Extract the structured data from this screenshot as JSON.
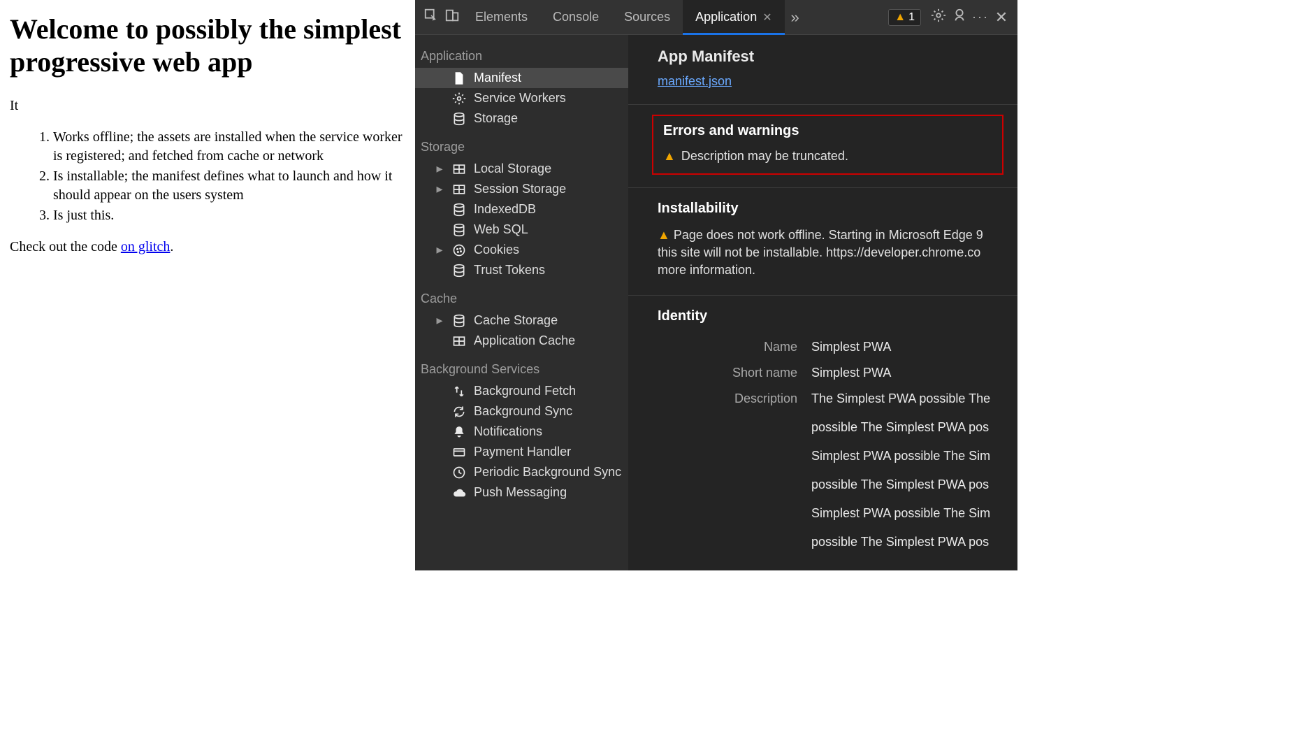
{
  "page": {
    "heading": "Welcome to possibly the simplest progressive web app",
    "intro": "It",
    "list": [
      "Works offline; the assets are installed when the service worker is registered; and fetched from cache or network",
      "Is installable; the manifest defines what to launch and how it should appear on the users system",
      "Is just this."
    ],
    "outro_prefix": "Check out the code ",
    "outro_link": "on glitch",
    "outro_suffix": "."
  },
  "devtools": {
    "tabs": {
      "elements": "Elements",
      "console": "Console",
      "sources": "Sources",
      "application": "Application"
    },
    "warning_count": "1",
    "sidebar": {
      "application": {
        "title": "Application",
        "items": [
          {
            "icon": "file",
            "label": "Manifest",
            "selected": true
          },
          {
            "icon": "gear",
            "label": "Service Workers"
          },
          {
            "icon": "db",
            "label": "Storage"
          }
        ]
      },
      "storage": {
        "title": "Storage",
        "items": [
          {
            "icon": "grid",
            "label": "Local Storage",
            "expandable": true
          },
          {
            "icon": "grid",
            "label": "Session Storage",
            "expandable": true
          },
          {
            "icon": "db",
            "label": "IndexedDB"
          },
          {
            "icon": "db",
            "label": "Web SQL"
          },
          {
            "icon": "cookie",
            "label": "Cookies",
            "expandable": true
          },
          {
            "icon": "db",
            "label": "Trust Tokens"
          }
        ]
      },
      "cache": {
        "title": "Cache",
        "items": [
          {
            "icon": "db",
            "label": "Cache Storage",
            "expandable": true
          },
          {
            "icon": "grid",
            "label": "Application Cache"
          }
        ]
      },
      "bgservices": {
        "title": "Background Services",
        "items": [
          {
            "icon": "updown",
            "label": "Background Fetch"
          },
          {
            "icon": "sync",
            "label": "Background Sync"
          },
          {
            "icon": "bell",
            "label": "Notifications"
          },
          {
            "icon": "card",
            "label": "Payment Handler"
          },
          {
            "icon": "clock",
            "label": "Periodic Background Sync"
          },
          {
            "icon": "cloud",
            "label": "Push Messaging"
          }
        ]
      }
    },
    "detail": {
      "title": "App Manifest",
      "manifest_link": "manifest.json",
      "errors_title": "Errors and warnings",
      "error_msg": "Description may be truncated.",
      "install_title": "Installability",
      "install_msg": "Page does not work offline. Starting in Microsoft Edge 9 this site will not be installable. https://developer.chrome.co more information.",
      "identity_title": "Identity",
      "identity": {
        "name_k": "Name",
        "name_v": "Simplest PWA",
        "short_k": "Short name",
        "short_v": "Simplest PWA",
        "desc_k": "Description",
        "desc_lines": [
          "The Simplest PWA possible The",
          "possible The Simplest PWA pos",
          "Simplest PWA possible The Sim",
          "possible The Simplest PWA pos",
          "Simplest PWA possible The Sim",
          "possible The Simplest PWA pos"
        ]
      }
    }
  }
}
